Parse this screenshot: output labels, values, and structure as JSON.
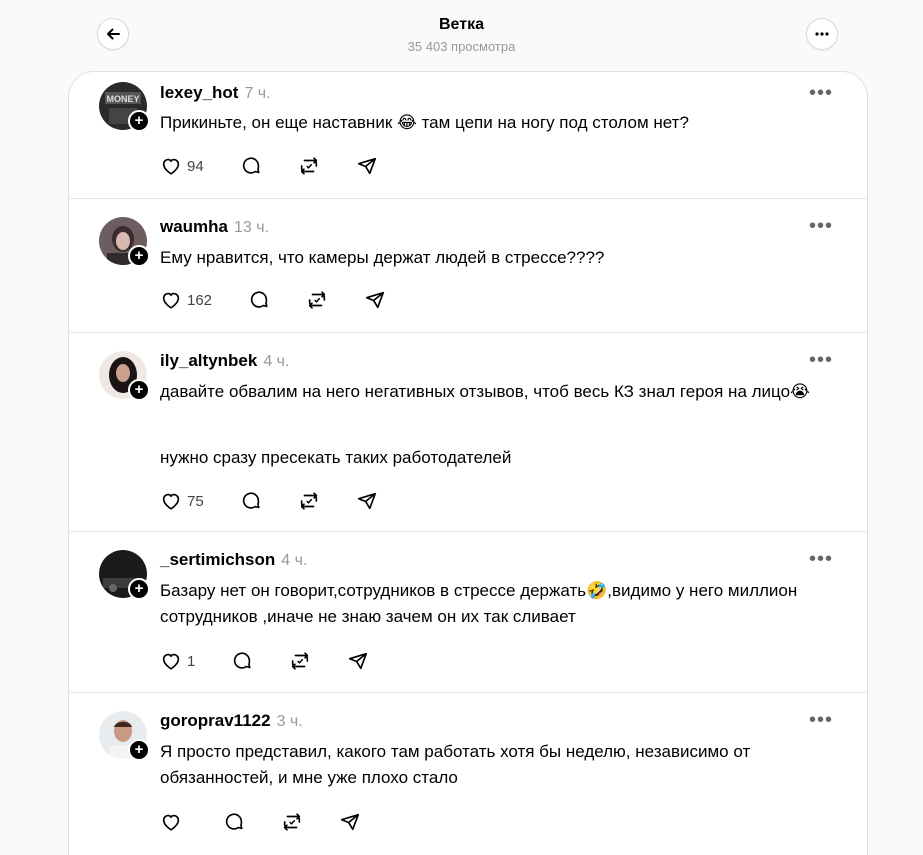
{
  "header": {
    "title": "Ветка",
    "views": "35 403 просмотра"
  },
  "posts": [
    {
      "username": "lexey_hot",
      "time": "7 ч.",
      "text1": "Прикиньте, он еще наставник ",
      "emoji1": "😂",
      "text2": " там цепи на ногу под столом нет?",
      "likes": "94"
    },
    {
      "username": "waumha",
      "time": "13 ч.",
      "text1": "Ему нравится, что камеры держат людей в стрессе????",
      "likes": "162"
    },
    {
      "username": "ily_altynbek",
      "time": "4 ч.",
      "text1": "давайте обвалим на него негативных отзывов, чтоб весь КЗ знал героя на лицо",
      "emoji1": "😭",
      "text3": "нужно сразу пресекать таких работодателей",
      "likes": "75"
    },
    {
      "username": "_sertimichson",
      "time": "4 ч.",
      "text1": "Базару нет он говорит,сотрудников в стрессе держать",
      "emoji1": "🤣",
      "text2": ",видимо у него миллион сотрудников ,иначе не знаю зачем он их так сливает",
      "likes": "1"
    },
    {
      "username": "goroprav1122",
      "time": "3 ч.",
      "text1": "Я просто представил, какого там работать хотя бы неделю, независимо от обязанностей, и мне уже плохо стало",
      "likes": ""
    }
  ]
}
